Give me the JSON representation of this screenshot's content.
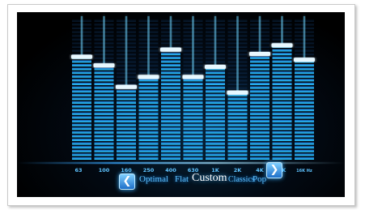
{
  "equalizer": {
    "accent": "#2ab7ff",
    "bands": [
      {
        "label": "63",
        "level": 0.72
      },
      {
        "label": "100",
        "level": 0.66
      },
      {
        "label": "160",
        "level": 0.51
      },
      {
        "label": "250",
        "level": 0.58
      },
      {
        "label": "400",
        "level": 0.77
      },
      {
        "label": "630",
        "level": 0.58
      },
      {
        "label": "1K",
        "level": 0.65
      },
      {
        "label": "2K",
        "level": 0.47
      },
      {
        "label": "4K",
        "level": 0.74
      },
      {
        "label": "8K",
        "level": 0.8
      },
      {
        "label": "16K",
        "level": 0.7
      }
    ],
    "unit_suffix": "Hz"
  },
  "presets": {
    "prev_icon": "chevron-left-icon",
    "next_icon": "chevron-right-icon",
    "items": [
      "Optimal",
      "Flat",
      "Custom",
      "Classics",
      "Pop"
    ],
    "active": "Custom"
  }
}
